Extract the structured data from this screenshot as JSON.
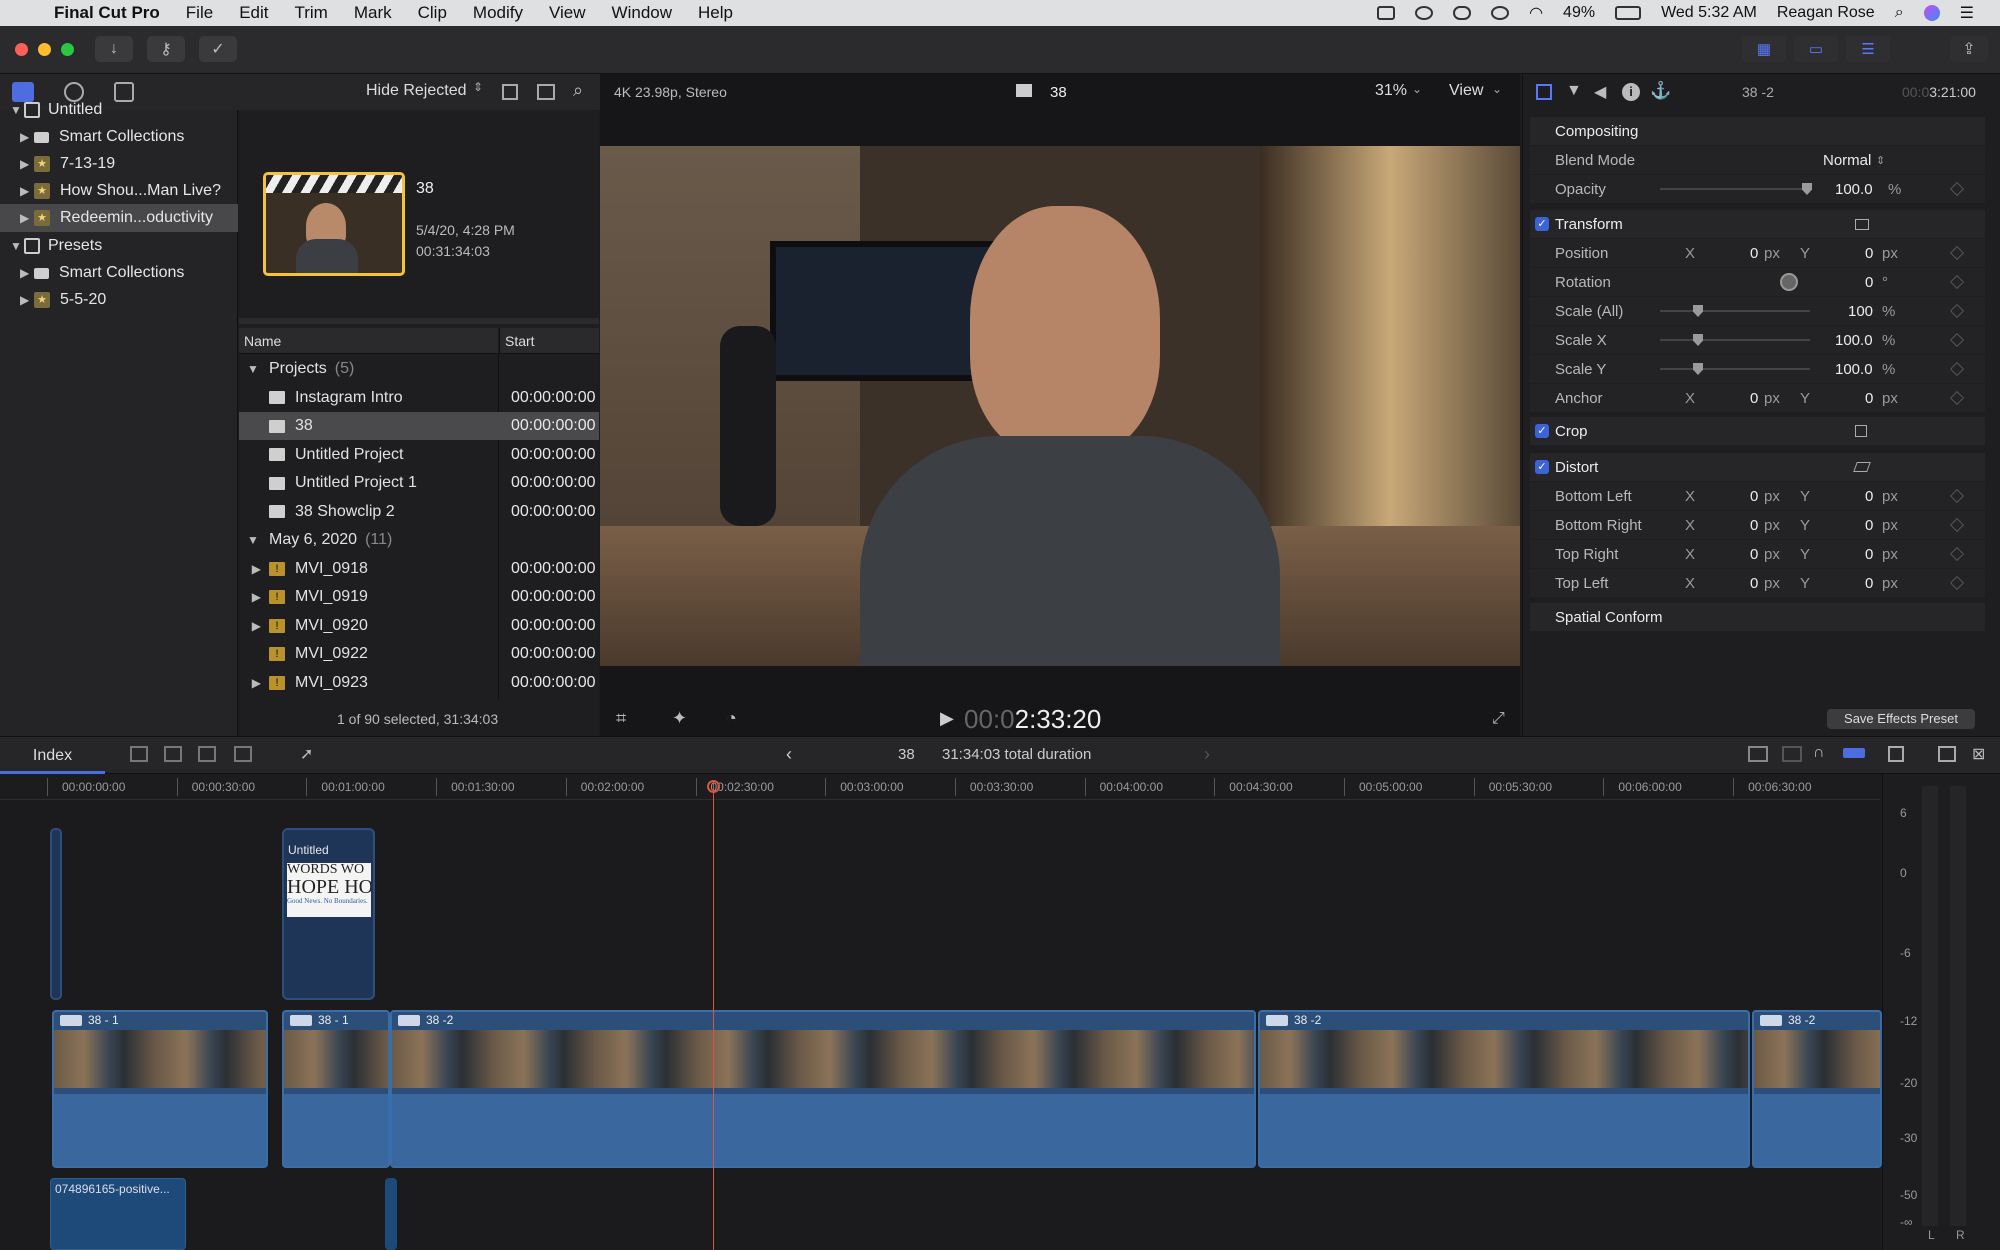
{
  "menubar": {
    "app_name": "Final Cut Pro",
    "menus": [
      "File",
      "Edit",
      "Trim",
      "Mark",
      "Clip",
      "Modify",
      "View",
      "Window",
      "Help"
    ],
    "battery": "49%",
    "clock": "Wed 5:32 AM",
    "user": "Reagan Rose"
  },
  "library": {
    "items": [
      {
        "label": "Untitled",
        "icon": "library-icon",
        "level": 0,
        "expanded": true
      },
      {
        "label": "Smart Collections",
        "icon": "folder-icon",
        "level": 1,
        "expanded": false
      },
      {
        "label": "7-13-19",
        "icon": "event-icon",
        "level": 1,
        "expanded": false
      },
      {
        "label": "How Shou...Man Live?",
        "icon": "event-icon",
        "level": 1,
        "expanded": false
      },
      {
        "label": "Redeemin...oductivity",
        "icon": "event-icon",
        "level": 1,
        "expanded": false,
        "selected": true
      },
      {
        "label": "Presets",
        "icon": "library-icon",
        "level": 0,
        "expanded": true
      },
      {
        "label": "Smart Collections",
        "icon": "folder-icon",
        "level": 1,
        "expanded": false
      },
      {
        "label": "5-5-20",
        "icon": "event-icon",
        "level": 1,
        "expanded": false
      }
    ]
  },
  "browser": {
    "filter": "Hide Rejected",
    "preview": {
      "title": "38",
      "date": "5/4/20, 4:28 PM",
      "duration": "00:31:34:03"
    },
    "columns": {
      "name": "Name",
      "start": "Start"
    },
    "groups": [
      {
        "label": "Projects",
        "count": "(5)",
        "rows": [
          {
            "name": "Instagram Intro",
            "start": "00:00:00:00",
            "icon": "project-icon"
          },
          {
            "name": "38",
            "start": "00:00:00:00",
            "icon": "project-icon",
            "selected": true
          },
          {
            "name": "Untitled Project",
            "start": "00:00:00:00",
            "icon": "project-icon"
          },
          {
            "name": "Untitled Project 1",
            "start": "00:00:00:00",
            "icon": "project-icon"
          },
          {
            "name": "38 Showclip 2",
            "start": "00:00:00:00",
            "icon": "project-icon"
          }
        ]
      },
      {
        "label": "May 6, 2020",
        "count": "(11)",
        "rows": [
          {
            "name": "MVI_0918",
            "start": "00:00:00:00",
            "icon": "warning-clip-icon"
          },
          {
            "name": "MVI_0919",
            "start": "00:00:00:00",
            "icon": "warning-clip-icon"
          },
          {
            "name": "MVI_0920",
            "start": "00:00:00:00",
            "icon": "warning-clip-icon"
          },
          {
            "name": "MVI_0922",
            "start": "00:00:00:00",
            "icon": "warning-clip-icon"
          },
          {
            "name": "MVI_0923",
            "start": "00:00:00:00",
            "icon": "warning-clip-icon"
          }
        ]
      }
    ],
    "status": "1 of 90 selected, 31:34:03"
  },
  "viewer": {
    "format": "4K 23.98p, Stereo",
    "title": "38",
    "zoom": "31%",
    "view_menu": "View",
    "timecode_dim": "00:0",
    "timecode": "2:33:20"
  },
  "inspector": {
    "clip_name": "38 -2",
    "duration_dim": "00:0",
    "duration": "3:21:00",
    "compositing": {
      "header": "Compositing",
      "blend_label": "Blend Mode",
      "blend_value": "Normal",
      "opacity_label": "Opacity",
      "opacity_value": "100.0",
      "opacity_unit": "%",
      "opacity_level": 1.0
    },
    "transform": {
      "header": "Transform",
      "position": {
        "label": "Position",
        "x": "0",
        "y": "0",
        "unit": "px"
      },
      "rotation": {
        "label": "Rotation",
        "value": "0",
        "unit": "°"
      },
      "scale_all": {
        "label": "Scale (All)",
        "value": "100",
        "unit": "%"
      },
      "scale_x": {
        "label": "Scale X",
        "value": "100.0",
        "unit": "%"
      },
      "scale_y": {
        "label": "Scale Y",
        "value": "100.0",
        "unit": "%"
      },
      "anchor": {
        "label": "Anchor",
        "x": "0",
        "y": "0",
        "unit": "px"
      }
    },
    "crop": {
      "header": "Crop"
    },
    "distort": {
      "header": "Distort",
      "rows": [
        {
          "label": "Bottom Left",
          "x": "0",
          "y": "0",
          "unit": "px"
        },
        {
          "label": "Bottom Right",
          "x": "0",
          "y": "0",
          "unit": "px"
        },
        {
          "label": "Top Right",
          "x": "0",
          "y": "0",
          "unit": "px"
        },
        {
          "label": "Top Left",
          "x": "0",
          "y": "0",
          "unit": "px"
        }
      ]
    },
    "spatial_conform": "Spatial Conform",
    "axis_x": "X",
    "axis_y": "Y",
    "save_preset": "Save Effects Preset"
  },
  "timeline": {
    "index_label": "Index",
    "project_name": "38",
    "total_duration": "31:34:03 total duration",
    "ruler": [
      "00:00:00:00",
      "00:00:30:00",
      "00:01:00:00",
      "00:01:30:00",
      "00:02:00:00",
      "00:02:30:00",
      "00:03:00:00",
      "00:03:30:00",
      "00:04:00:00",
      "00:04:30:00",
      "00:05:00:00",
      "00:05:30:00",
      "00:06:00:00",
      "00:06:30:00"
    ],
    "title_clip": {
      "label": "Untitled",
      "line1": "WORDS WO",
      "line2": "HOPE HO",
      "line3": "Good News. No Boundaries."
    },
    "clips": [
      "38 - 1",
      "38 - 1",
      "38 -2",
      "38 -2",
      "38 -2"
    ],
    "audio_clip": "074896165-positive...",
    "meter_labels": [
      "6",
      "0",
      "-6",
      "-12",
      "-20",
      "-30",
      "-50",
      "-∞"
    ],
    "meter_channels": [
      "L",
      "R"
    ]
  }
}
